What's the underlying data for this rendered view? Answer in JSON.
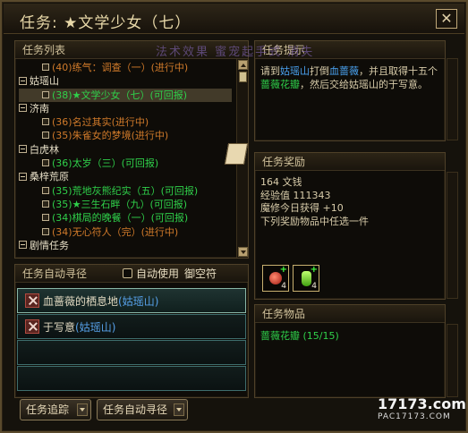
{
  "window": {
    "title": "任务: ★文学少女（七）",
    "close_label": "✕"
  },
  "task_list": {
    "header": "任务列表",
    "rows": [
      {
        "type": "task",
        "text": "(40)练气：调查（一）(进行中)",
        "color": "orange"
      },
      {
        "type": "cat",
        "text": "姑瑶山"
      },
      {
        "type": "task",
        "text": "(38)★文学少女（七）(可回报)",
        "color": "green",
        "selected": true
      },
      {
        "type": "cat",
        "text": "济南"
      },
      {
        "type": "task",
        "text": "(36)名过其实(进行中)",
        "color": "orange"
      },
      {
        "type": "task",
        "text": "(35)朱雀女的梦境(进行中)",
        "color": "orange"
      },
      {
        "type": "cat",
        "text": "白虎林"
      },
      {
        "type": "task",
        "text": "(36)太岁（三）(可回报)",
        "color": "green"
      },
      {
        "type": "cat",
        "text": "桑梓荒原"
      },
      {
        "type": "task",
        "text": "(35)荒地灰熊纪实（五）(可回报)",
        "color": "green"
      },
      {
        "type": "task",
        "text": "(35)★三生石畔（九）(可回报)",
        "color": "green"
      },
      {
        "type": "task",
        "text": "(34)棋局的晚餐（一）(可回报)",
        "color": "green"
      },
      {
        "type": "task",
        "text": "(34)无心符人（完）(进行中)",
        "color": "orange"
      },
      {
        "type": "cat",
        "text": "剧情任务"
      }
    ]
  },
  "auto_path": {
    "header": "任务自动寻径",
    "auto_use_label": "自动使用",
    "fly_label": "御空符",
    "rows": [
      {
        "text": "血蔷薇的栖息地",
        "place": "(姑瑶山)",
        "active": true
      },
      {
        "text": "于写意",
        "place": "(姑瑶山)",
        "active": false
      }
    ]
  },
  "buttons": {
    "track": "任务追踪",
    "auto_path": "任务自动寻径"
  },
  "hint": {
    "header": "任务提示",
    "text_parts": [
      "请到",
      "姑瑶山",
      "打倒",
      "血蔷薇",
      "，并且取得十五个",
      "蔷薇花瓣",
      "，然后交给姑瑶山的于写意。"
    ]
  },
  "reward": {
    "header": "任务奖励",
    "money": "164 文钱",
    "exp": "经验值 111343",
    "daily": "魔修今日获得 +10",
    "choose": "下列奖励物品中任选一件",
    "slots": [
      {
        "icon": "red-gem-icon",
        "qty": "4"
      },
      {
        "icon": "green-potion-icon",
        "qty": "4"
      }
    ]
  },
  "items": {
    "header": "任务物品",
    "rows": [
      {
        "name": "蔷薇花瓣",
        "count": "(15/15)"
      }
    ]
  },
  "watermark": {
    "line1": "法术效果  蜜宠起手式  消失"
  },
  "site_logo": {
    "line1": "17173.com",
    "line2": "PAC17173.COM"
  },
  "colors": {
    "in_progress": "#d07a2a",
    "completable": "#2fd04a",
    "npc_blue": "#4aa2f0"
  }
}
